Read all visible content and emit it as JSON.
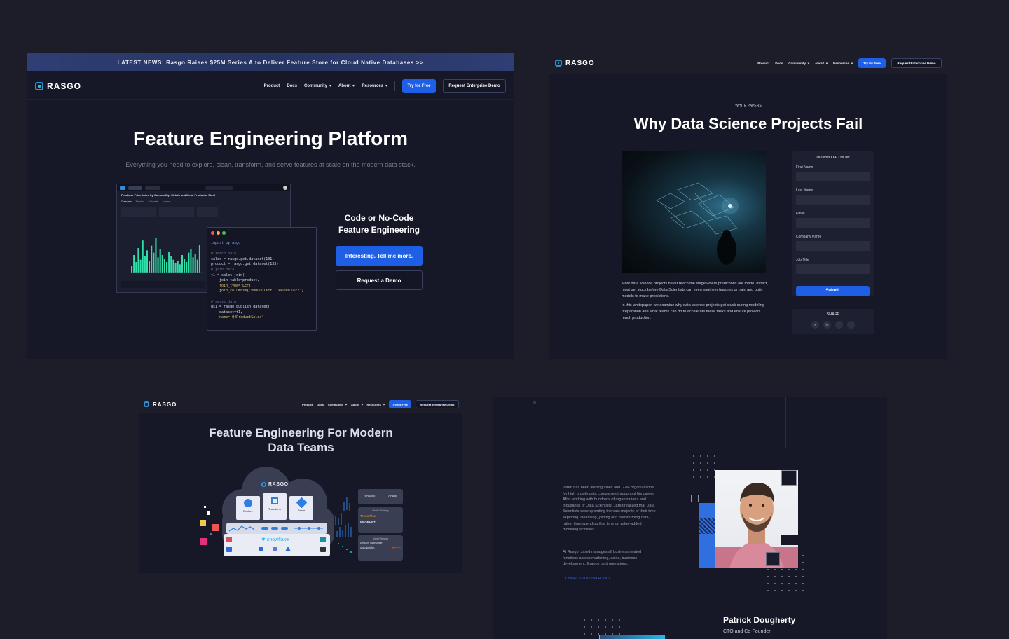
{
  "colors": {
    "background": "#1c1d29",
    "panel": "#161827",
    "accent_blue": "#1f5fe6",
    "teal": "#1ec6c6"
  },
  "brand": {
    "logo_text": "RASGO"
  },
  "nav": {
    "product": "Product",
    "docs": "Docs",
    "community": "Community",
    "about": "About",
    "resources": "Resources",
    "try_free": "Try for Free",
    "enterprise_demo": "Request Enterprise Demo"
  },
  "panel1": {
    "banner_label": "LATEST NEWS:",
    "banner_text": "Rasgo Raises $25M Series A to Deliver Feature Store for Cloud Native Databases >>",
    "title": "Feature Engineering Platform",
    "subtitle": "Everything you need to explore, clean, transform, and serve features at scale on the modern data stack.",
    "cta_heading_line1": "Code or No-Code",
    "cta_heading_line2": "Feature Engineering",
    "primary_cta": "Interesting. Tell me more.",
    "secondary_cta": "Request a Demo",
    "dashboard_title": "Producer Price Index by Commodity: Metals and Metal Products: Steel",
    "dashboard_tabs": [
      "Overview",
      "Related",
      "Datasets",
      "Access"
    ],
    "code_lines": [
      "import pyrasgo",
      "",
      "# fetch data",
      "sales = rasgo.get.dataset(101)",
      "product = rasgo.get.dataset(133)",
      "# join data",
      "t1 = sales.join(",
      "    join_table=product,",
      "    join_type='LEFT',",
      "    join_columns={'PRODUCTKEY':'PRODUCTKEY'}",
      ")",
      "# serve data",
      "ds1 = rasgo.publish.dataset(",
      "    dataset=t1,",
      "    name='Q4ProductSales'",
      ")"
    ],
    "bar_values": [
      12,
      30,
      18,
      42,
      22,
      55,
      28,
      38,
      20,
      46,
      34,
      60,
      26,
      40,
      30,
      24,
      18,
      36,
      28,
      22,
      16,
      20,
      14,
      30,
      24,
      18,
      34,
      40,
      26,
      32,
      22,
      48
    ]
  },
  "panel2": {
    "eyebrow": "WHITE PAPERS",
    "title": "Why Data Science Projects Fail",
    "paragraph1": "Most data science projects never reach the stage where predictions are made. In fact, most get stuck before Data Scientists can even engineer features or train and build models to make predictions.",
    "paragraph2": "In this whitepaper, we examine why data science projects get stuck during modeling preparation and what teams can do to accelerate these tasks and ensure projects reach production.",
    "form": {
      "heading": "DOWNLOAD NOW",
      "fields": [
        "First Name",
        "Last Name",
        "Email",
        "Company Name",
        "Job Title"
      ],
      "submit": "Submit"
    },
    "share": {
      "heading": "SHARE",
      "icons": [
        "link-icon",
        "linkedin-icon",
        "facebook-icon",
        "twitter-icon"
      ]
    }
  },
  "panel3": {
    "title_line1": "Feature Engineering For Modern",
    "title_line2": "Data Teams",
    "cloud_logo": "RASGO",
    "cards": [
      "Explore",
      "Transform",
      "Serve"
    ],
    "snowflake": "snowflake",
    "integrations": {
      "bi": [
        "tableau",
        "Looker"
      ],
      "training_label": "Model Training",
      "training": [
        "TensorFlow",
        "PROPHET"
      ],
      "serving_label": "Model Serving",
      "serving": [
        "Amazon SageMaker",
        "databricks",
        "jupyter"
      ]
    }
  },
  "panel4": {
    "bio1": "Jared has been leading sales and G2M organizations for high growth data companies throughout his career. After working with hundreds of organizations and thousands of Data Scientists, Jared realized that Data Scientists were spending the vast majority of their time exploring, cleansing, joining and transforming data, rather than spending that time on value-added modeling activities.",
    "bio2": "At Rasgo, Jared manages all business related functions across marketing, sales, business development, finance, and operations.",
    "link": "CONNECT ON LINKEDIN  >",
    "name": "Patrick Dougherty",
    "role": "CTO and Co-Founder"
  }
}
